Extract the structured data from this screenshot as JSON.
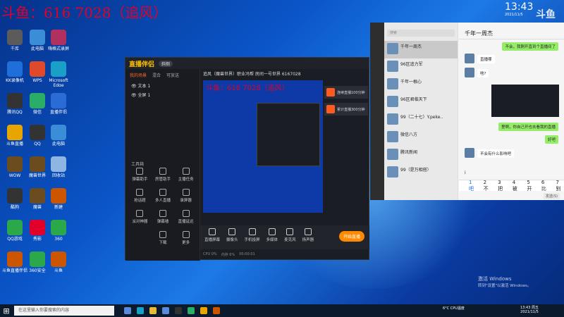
{
  "overlay_title": "斗鱼：616 7028（追风）",
  "clock": {
    "time": "13:43",
    "date": "2021/11/5"
  },
  "watermark": "斗鱼",
  "desktop_icons": [
    {
      "label": "千库",
      "color": "#5b5b5b"
    },
    {
      "label": "此电脑",
      "color": "#3c8dd8"
    },
    {
      "label": "嗨格式录屏",
      "color": "#b03060"
    },
    {
      "label": "KK录像机",
      "color": "#1e6fd9"
    },
    {
      "label": "WPS",
      "color": "#e04a2a"
    },
    {
      "label": "Microsoft Edge",
      "color": "#1aa0c8"
    },
    {
      "label": "腾讯QQ",
      "color": "#333"
    },
    {
      "label": "微信",
      "color": "#2aae67"
    },
    {
      "label": "直播伴侣",
      "color": "#2a6bd6"
    },
    {
      "label": "斗鱼直播",
      "color": "#e8a500"
    },
    {
      "label": "QQ",
      "color": "#333"
    },
    {
      "label": "此电脑",
      "color": "#3c8dd8"
    },
    {
      "label": "WOW",
      "color": "#6b4c1e"
    },
    {
      "label": "魔兽世界",
      "color": "#6b4c1e"
    },
    {
      "label": "回收站",
      "color": "#8fb6e2"
    },
    {
      "label": "酷狗",
      "color": "#333"
    },
    {
      "label": "魔兽",
      "color": "#6b4c1e"
    },
    {
      "label": "新建",
      "color": "#cc5500"
    },
    {
      "label": "QQ游戏",
      "color": "#2aa84a"
    },
    {
      "label": "秀影",
      "color": "#e0002a"
    },
    {
      "label": "360",
      "color": "#2aa84a"
    },
    {
      "label": "斗鱼直播伴侣",
      "color": "#cc5500"
    },
    {
      "label": "360安全",
      "color": "#2aa84a"
    },
    {
      "label": "斗鱼",
      "color": "#cc5500"
    }
  ],
  "stream_app": {
    "logo_a": "直播",
    "logo_b": "伴侣",
    "version_chip": "斜侧",
    "tabs": [
      "我的场景",
      "混合",
      "可放送"
    ],
    "scenes": [
      "文本 1",
      "全屏 1"
    ],
    "room_line": "追风（魔兽世界）职业冯帮   房间一号世界  6167028",
    "tools_header": "工具箱",
    "tools": [
      "弹幕助手",
      "房管助手",
      "主播任务",
      "抢话题",
      "多人直播",
      "录屏器",
      "派对神器",
      "弹幕墙",
      "直播延迟",
      "",
      "下载",
      "更多"
    ],
    "tasks": [
      "连续直播100分钟",
      "累计直播300分钟"
    ],
    "bottom_tools": [
      "直播屏幕",
      "摄像头",
      "手机投屏",
      "多媒体",
      "麦克风",
      "扬声器"
    ],
    "start_button": "开始直播",
    "status": [
      "CPU 0%",
      "内存 6%",
      "00:00:01"
    ]
  },
  "chat": {
    "search_placeholder": "搜索",
    "title": "千年一周杰",
    "conversations": [
      "千年一周杰",
      "96区追力军",
      "千年一根心",
      "96区君临天下",
      "99（二十七）Y.peke..",
      "微信八方",
      "腾讯新闻",
      "99（是万相搭）"
    ],
    "messages": [
      {
        "side": "g",
        "text": "不会，我刚开直到个直播间了"
      },
      {
        "side": "w",
        "text": "直播哪"
      },
      {
        "side": "w",
        "text": "啥?"
      },
      {
        "side": "g",
        "text": "里啊，你自己开也去看我的直播"
      },
      {
        "side": "g",
        "text": "好吧"
      },
      {
        "side": "w",
        "text": "不会有什么影响吧"
      }
    ],
    "input_text": "i",
    "ime_candidates": [
      "1 吧",
      "2 不",
      "3 把",
      "4 被",
      "5 开",
      "6 比",
      "7 别"
    ],
    "send": "发送(S)"
  },
  "activate": {
    "line1": "激活 Windows",
    "line2": "转到\"设置\"以激活 Windows。"
  },
  "taskbar": {
    "search_placeholder": "在这里输入你要搜索的内容",
    "weather": "6°C  CPU温度",
    "tray_time": "13:43 周五",
    "tray_date": "2021/11/5"
  }
}
